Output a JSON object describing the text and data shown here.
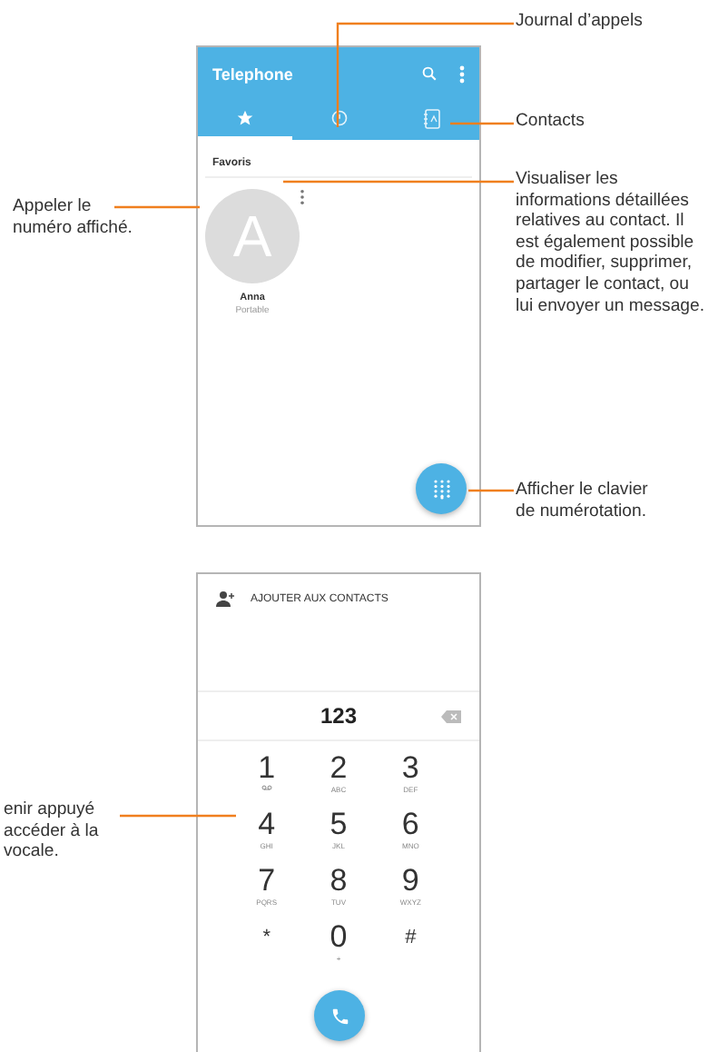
{
  "callouts": [
    {
      "lines": [
        "Journal d’appels"
      ]
    },
    {
      "lines": [
        "Contacts"
      ]
    },
    {
      "lines": [
        "Appeler le",
        "numéro affiché."
      ]
    },
    {
      "lines": [
        "Visualiser les",
        "informations détaillées",
        "relatives au contact. Il",
        "est également possible",
        "de modifier, supprimer,",
        "partager le contact, ou",
        "lui envoyer un message."
      ]
    },
    {
      "lines": [
        "Afficher le clavier",
        "de numérotation."
      ]
    },
    {
      "lines": [
        "enir appuyé",
        "accéder à la",
        "vocale."
      ]
    }
  ],
  "phone_app": {
    "title": "Telephone",
    "tabs": [
      {
        "selected": true
      },
      {
        "selected": false
      },
      {
        "selected": false
      }
    ],
    "section": "Favoris",
    "favorites": [
      {
        "initial": "A",
        "name": "Anna",
        "type": "Portable"
      }
    ]
  },
  "dialer": {
    "add_contact": "AJOUTER AUX CONTACTS",
    "number": "123",
    "keys": [
      {
        "digit": "1",
        "kind": "voicemail"
      },
      {
        "digit": "2",
        "letters": "ABC",
        "kind": "digit"
      },
      {
        "digit": "3",
        "letters": "DEF",
        "kind": "digit"
      },
      {
        "digit": "4",
        "letters": "GHI",
        "kind": "digit"
      },
      {
        "digit": "5",
        "letters": "JKL",
        "kind": "digit"
      },
      {
        "digit": "6",
        "letters": "MNO",
        "kind": "digit"
      },
      {
        "digit": "7",
        "letters": "PQRS",
        "kind": "digit"
      },
      {
        "digit": "8",
        "letters": "TUV",
        "kind": "digit"
      },
      {
        "digit": "9",
        "letters": "WXYZ",
        "kind": "digit"
      },
      {
        "digit": "*",
        "kind": "symbol"
      },
      {
        "digit": "0",
        "letters": "+",
        "kind": "digit"
      },
      {
        "digit": "#",
        "kind": "symbol"
      }
    ]
  }
}
